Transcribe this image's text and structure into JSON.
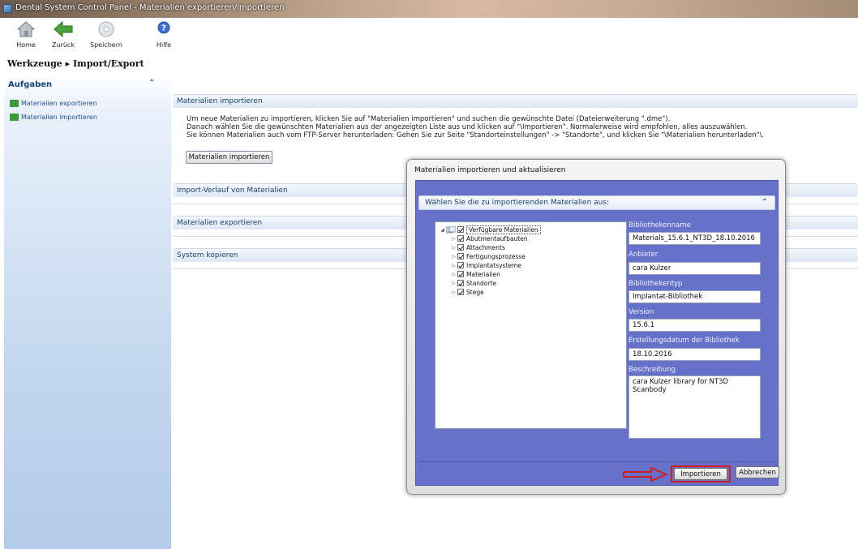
{
  "window": {
    "title": "Dental System Control Panel - Materialien exportieren/importieren"
  },
  "toolbar": {
    "home": "Home",
    "back": "Zurück",
    "save": "Speichern",
    "help": "Hilfe"
  },
  "breadcrumb": {
    "parent": "Werkzeuge",
    "separator": "▸",
    "current": "Import/Export"
  },
  "sidebar": {
    "heading": "Aufgaben",
    "collapse": "⌃",
    "items": [
      {
        "label": "Materialien exportieren",
        "icon": "export-icon"
      },
      {
        "label": "Materialien importieren",
        "icon": "import-icon"
      }
    ]
  },
  "main": {
    "panels": [
      {
        "title": "Materialien importieren"
      },
      {
        "title": "Import-Verlauf von Materialien"
      },
      {
        "title": "Materialien exportieren"
      },
      {
        "title": "System kopieren"
      }
    ],
    "description": [
      "Um neue Materialien zu importieren, klicken Sie auf \"Materialien importieren\" und suchen die gewünschte Datei (Dateierweiterung \".dme\").",
      "Danach wählen Sie die gewünschten Materialien aus der angezeigten Liste aus und klicken auf \"\\Importieren\". Normalerweise wird empfohlen, alles auszuwählen.",
      "Sie können Materialien auch vom FTP-Server herunterladen: Gehen Sie zur Seite \"Standorteinstellungen\" -> \"Standorte\", und klicken Sie \"\\Materialien herunterladen\"\\."
    ],
    "import_button": "Materialien importieren"
  },
  "dialog": {
    "title": "Materialien importieren und aktualisieren",
    "subheader": "Wählen Sie die zu importierenden Materialien aus:",
    "subheader_collapse": "⌃",
    "tree": {
      "root": "Verfügbare Materialien",
      "children": [
        "Abutmentaufbauten",
        "Attachments",
        "Fertigungsprozesse",
        "Implantatsysteme",
        "Materialien",
        "Standorte",
        "Stege"
      ]
    },
    "fields": {
      "library_name_label": "Bibliothekenname",
      "library_name": "Materials_15.6.1_NT3D_18.10.2016",
      "provider_label": "Anbieter",
      "provider": "cara Kulzer",
      "library_type_label": "Bibliothekentyp",
      "library_type": "Implantat-Bibliothek",
      "version_label": "Version",
      "version": "15.6.1",
      "created_label": "Erstellungsdatum der Bibliothek",
      "created": "18.10.2016",
      "description_label": "Beschreibung",
      "description": "cara Kulzer library for NT3D\nScanbody"
    },
    "import_button": "Importieren",
    "cancel_button": "Abbrechen",
    "annotation_color": "#d21d1d"
  }
}
